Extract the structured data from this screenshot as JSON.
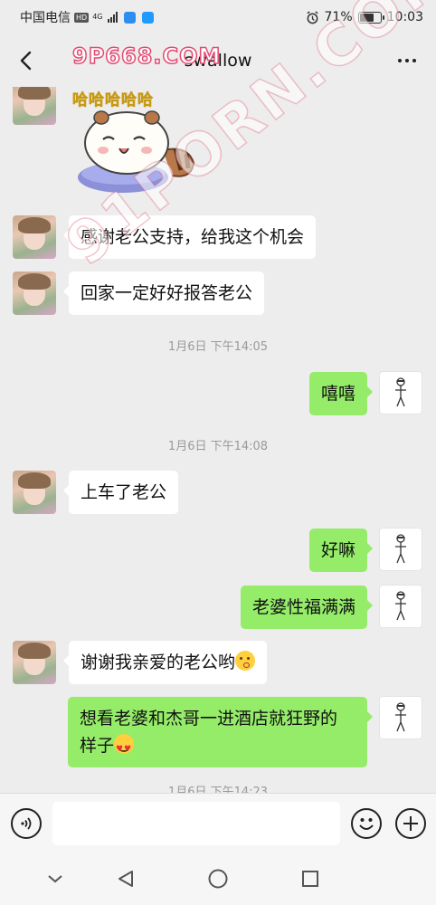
{
  "status_bar": {
    "carrier": "中国电信",
    "network_badge": "HD",
    "network_type": "4G",
    "battery_percent": "71%",
    "battery_level": 0.71,
    "time": "10:03",
    "icons": [
      "signal-icon",
      "search-app-icon",
      "assistant-app-icon",
      "alarm-icon",
      "battery-icon"
    ]
  },
  "watermarks": {
    "top": "9P668.COM",
    "diagonal": "91PORN.COM"
  },
  "header": {
    "title": "swallow",
    "back_icon": "back-chevron-icon",
    "more_icon": "more-dots-icon"
  },
  "messages": [
    {
      "side": "left",
      "type": "sticker",
      "sticker_text": "哈哈哈哈哈"
    },
    {
      "side": "left",
      "type": "text",
      "text": "感谢老公支持，给我这个机会"
    },
    {
      "side": "left",
      "type": "text",
      "text": "回家一定好好报答老公"
    },
    {
      "type": "timestamp",
      "text": "1月6日 下午14:05"
    },
    {
      "side": "right",
      "type": "text",
      "text": "嘻嘻"
    },
    {
      "type": "timestamp",
      "text": "1月6日 下午14:08"
    },
    {
      "side": "left",
      "type": "text",
      "text": "上车了老公"
    },
    {
      "side": "right",
      "type": "text",
      "text": "好嘛"
    },
    {
      "side": "right",
      "type": "text",
      "text": "老婆性福满满"
    },
    {
      "side": "left",
      "type": "text",
      "text": "谢谢我亲爱的老公哟",
      "emoji": "kissing-face-emoji"
    },
    {
      "side": "right",
      "type": "text",
      "text_line1": "想看老婆和杰哥一进酒店就狂野的",
      "text_line2": "样子",
      "emoji": "heart-eyes-emoji"
    },
    {
      "type": "timestamp",
      "text": "1月6日 下午14:23"
    }
  ],
  "input_bar": {
    "voice_icon": "voice-input-icon",
    "placeholder": "",
    "emoji_icon": "emoji-icon",
    "plus_icon": "plus-icon"
  },
  "nav_bar": {
    "icons": [
      "nav-collapse-icon",
      "nav-back-icon",
      "nav-home-icon",
      "nav-recents-icon"
    ]
  }
}
